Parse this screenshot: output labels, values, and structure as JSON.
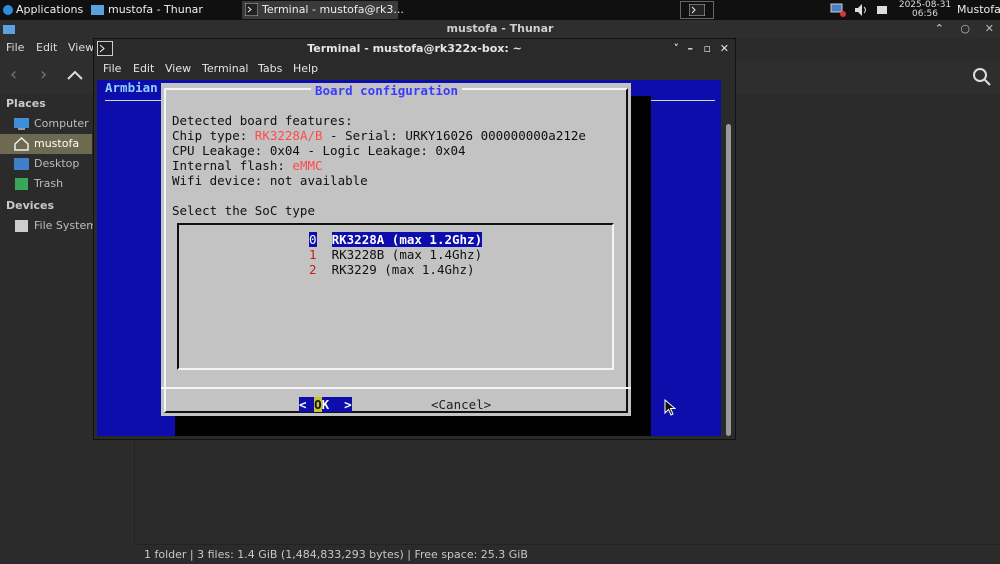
{
  "panel": {
    "applications": "Applications",
    "tasks": [
      {
        "label": "mustofa - Thunar",
        "icon": "folder-icon"
      },
      {
        "label": "Terminal - mustofa@rk3...",
        "icon": "terminal-icon"
      }
    ],
    "date": "2025-08-31",
    "time": "06:56",
    "user": "Mustofa"
  },
  "thunar": {
    "title": "mustofa - Thunar",
    "menu": [
      "File",
      "Edit",
      "View"
    ],
    "sidebar": {
      "places_header": "Places",
      "places": [
        "Computer",
        "mustofa",
        "Desktop",
        "Trash"
      ],
      "devices_header": "Devices",
      "devices": [
        "File System"
      ]
    },
    "status": "1 folder  |  3 files: 1.4 GiB (1,484,833,293 bytes)  |  Free space: 25.3 GiB"
  },
  "terminal": {
    "title": "Terminal - mustofa@rk322x-box: ~",
    "menu": [
      "File",
      "Edit",
      "View",
      "Terminal",
      "Tabs",
      "Help"
    ],
    "backtitle": "Armbian",
    "dialog": {
      "title": "Board configuration",
      "line1": "Detected board features:",
      "chip_prefix": "Chip type: ",
      "chip_value": "RK3228A/B",
      "chip_suffix": " - Serial: URKY16026 000000000a212e",
      "cpu_line": "CPU Leakage: 0x04 - Logic Leakage: 0x04",
      "flash_prefix": "Internal flash: ",
      "flash_value": "eMMC",
      "wifi_line": "Wifi device: not available",
      "prompt": "Select the SoC type",
      "options": [
        {
          "num": "0",
          "label": "RK3228A (max 1.2Ghz)"
        },
        {
          "num": "1",
          "label": "RK3228B (max 1.4Ghz)"
        },
        {
          "num": "2",
          "label": "RK3229 (max 1.4Ghz)"
        }
      ],
      "ok_left": "< ",
      "ok_k": "O",
      "ok_right": "K  >",
      "cancel": "<Cancel>"
    }
  }
}
